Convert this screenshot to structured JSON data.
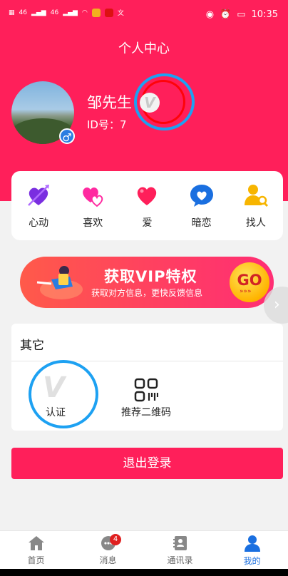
{
  "status_bar": {
    "time": "10:35",
    "left_text": "46",
    "left_text2": "46"
  },
  "header": {
    "title": "个人中心",
    "nickname": "邹先生",
    "user_id": "ID号：7",
    "vip_letter": "V",
    "gender_symbol": "♂"
  },
  "menu": {
    "items": [
      {
        "label": "心动",
        "icon": "heart-arrow-icon",
        "color": "#7a2ee0"
      },
      {
        "label": "喜欢",
        "icon": "double-heart-icon",
        "color": "#ff2aa0"
      },
      {
        "label": "爱",
        "icon": "heart-icon",
        "color": "#ff1f5a"
      },
      {
        "label": "暗恋",
        "icon": "chat-heart-icon",
        "color": "#1a6fe0"
      },
      {
        "label": "找人",
        "icon": "person-search-icon",
        "color": "#f7b500"
      }
    ]
  },
  "vip_banner": {
    "title": "获取VIP特权",
    "subtitle": "获取对方信息，更快反馈信息",
    "go_label": "GO",
    "go_arrows": "»»»"
  },
  "other": {
    "title": "其它",
    "items": [
      {
        "label": "认证",
        "icon_letter": "V"
      },
      {
        "label": "推荐二维码"
      }
    ]
  },
  "logout": {
    "label": "退出登录"
  },
  "bottom_nav": {
    "items": [
      {
        "label": "首页",
        "icon": "home-icon"
      },
      {
        "label": "消息",
        "icon": "message-icon",
        "badge": "4"
      },
      {
        "label": "通讯录",
        "icon": "contacts-icon"
      },
      {
        "label": "我的",
        "icon": "profile-icon",
        "active": true
      }
    ]
  },
  "colors": {
    "brand": "#ff1f5a",
    "active_nav": "#1a6fe0"
  }
}
